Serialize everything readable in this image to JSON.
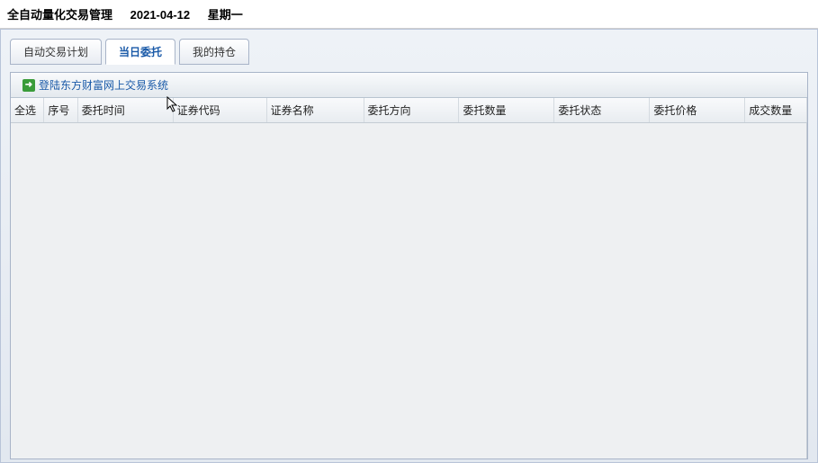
{
  "header": {
    "title": "全自动量化交易管理",
    "date": "2021-04-12",
    "weekday": "星期一"
  },
  "tabs": [
    {
      "label": "自动交易计划",
      "active": false
    },
    {
      "label": "当日委托",
      "active": true
    },
    {
      "label": "我的持仓",
      "active": false
    }
  ],
  "toolbar": {
    "login_label": "登陆东方财富网上交易系统"
  },
  "table": {
    "columns": {
      "select": "全选",
      "seq": "序号",
      "time": "委托时间",
      "code": "证券代码",
      "name": "证券名称",
      "direction": "委托方向",
      "qty": "委托数量",
      "status": "委托状态",
      "price": "委托价格",
      "dealqty": "成交数量"
    },
    "rows": []
  }
}
